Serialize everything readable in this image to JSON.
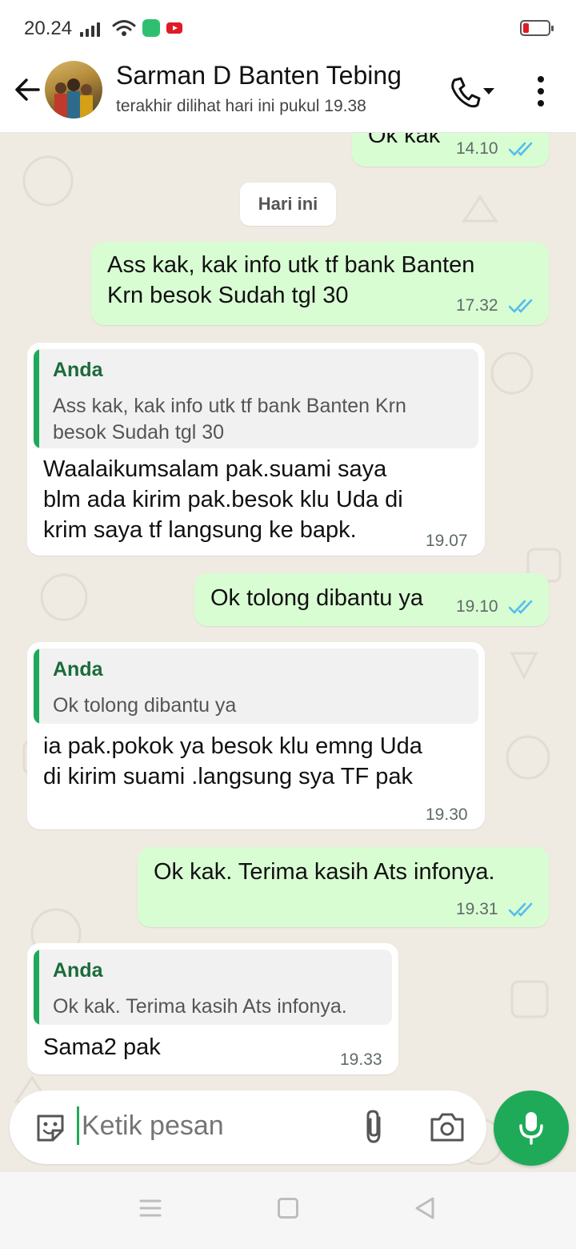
{
  "status_bar": {
    "time": "20.24",
    "icons": [
      "signal-icon",
      "wifi-icon",
      "app-notification-icon",
      "youtube-icon",
      "battery-low-icon"
    ]
  },
  "header": {
    "contact_name": "Sarman D Banten Tebing",
    "last_seen": "terakhir dilihat hari ini pukul 19.38",
    "icons": [
      "back-arrow-icon",
      "avatar",
      "phone-call-icon",
      "more-vert-icon"
    ]
  },
  "chat": {
    "date_divider": "Hari ini",
    "messages": [
      {
        "direction": "out",
        "text": "Ok kak",
        "time": "14.10",
        "status": "read"
      },
      {
        "direction": "out",
        "text": [
          "Ass kak, kak info utk tf bank Banten",
          "Krn besok Sudah tgl 30"
        ],
        "time": "17.32",
        "status": "read"
      },
      {
        "direction": "in",
        "quote": {
          "author": "Anda",
          "text": [
            "Ass kak, kak info utk tf bank Banten Krn",
            "besok Sudah tgl 30"
          ]
        },
        "text": [
          "Waalaikumsalam pak.suami saya",
          "blm ada kirim pak.besok klu Uda di",
          "krim saya tf langsung ke bapk."
        ],
        "time": "19.07"
      },
      {
        "direction": "out",
        "text": "Ok tolong dibantu ya",
        "time": "19.10",
        "status": "read"
      },
      {
        "direction": "in",
        "quote": {
          "author": "Anda",
          "text": [
            "Ok tolong dibantu ya"
          ]
        },
        "text": [
          "ia pak.pokok ya besok klu emng Uda",
          "di kirim suami .langsung sya TF pak"
        ],
        "time": "19.30"
      },
      {
        "direction": "out",
        "text": "Ok kak. Terima kasih Ats infonya.",
        "time": "19.31",
        "status": "read"
      },
      {
        "direction": "in",
        "quote": {
          "author": "Anda",
          "text": [
            "Ok kak. Terima kasih Ats infonya."
          ]
        },
        "text": [
          "Sama2 pak"
        ],
        "time": "19.33"
      }
    ]
  },
  "composer": {
    "placeholder": "Ketik pesan",
    "icons": [
      "sticker-icon",
      "attach-icon",
      "camera-icon",
      "mic-icon"
    ]
  },
  "nav_bar": {
    "icons": [
      "recents-icon",
      "home-icon",
      "back-icon"
    ]
  },
  "colors": {
    "outgoing_bubble": "#d9fdd3",
    "incoming_bubble": "#ffffff",
    "accent_green": "#1faa59",
    "read_ticks": "#53bdeb",
    "chat_background": "#efeae2"
  }
}
